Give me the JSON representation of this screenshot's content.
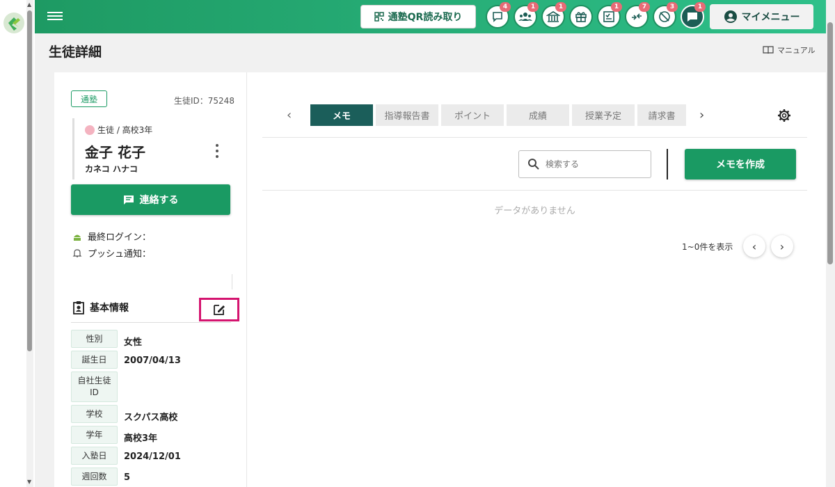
{
  "header": {
    "qr_label": "通塾QR読み取り",
    "icons": [
      {
        "name": "chat-bubble-icon",
        "badge": "4"
      },
      {
        "name": "group-icon",
        "badge": "1"
      },
      {
        "name": "school-icon",
        "badge": "1"
      },
      {
        "name": "gift-icon",
        "badge": ""
      },
      {
        "name": "checklist-icon",
        "badge": "1"
      },
      {
        "name": "transfer-arrows-icon",
        "badge": "7"
      },
      {
        "name": "no-location-icon",
        "badge": "3"
      },
      {
        "name": "message-icon",
        "badge": "1"
      }
    ],
    "my_menu": "マイメニュー"
  },
  "page": {
    "title": "生徒詳細",
    "manual": "マニュアル"
  },
  "student": {
    "status": "通塾",
    "id_label": "生徒ID：75248",
    "role": "生徒 / 高校3年",
    "name": "金子 花子",
    "kana": "カネコ ハナコ",
    "contact_button": "連絡する",
    "last_login": "最終ログイン：",
    "push": "プッシュ通知："
  },
  "basic_info": {
    "title": "基本情報",
    "rows": [
      {
        "label": "性別",
        "value": "女性"
      },
      {
        "label": "誕生日",
        "value": "2007/04/13"
      },
      {
        "label": "自社生徒ID",
        "value": ""
      },
      {
        "label": "学校",
        "value": "スクパス高校"
      },
      {
        "label": "学年",
        "value": "高校3年"
      },
      {
        "label": "入塾日",
        "value": "2024/12/01"
      },
      {
        "label": "週回数",
        "value": "5"
      }
    ]
  },
  "tabs": [
    "メモ",
    "指導報告書",
    "ポイント",
    "成績",
    "授業予定",
    "請求書"
  ],
  "active_tab": "メモ",
  "memo": {
    "search_placeholder": "検索する",
    "create_button": "メモを作成",
    "empty": "データがありません",
    "count": "1~0件を表示"
  },
  "colors": {
    "primary": "#1a9a63",
    "active_tab": "#1b5e5a",
    "badge": "#e86b76",
    "highlight": "#d4146f"
  }
}
